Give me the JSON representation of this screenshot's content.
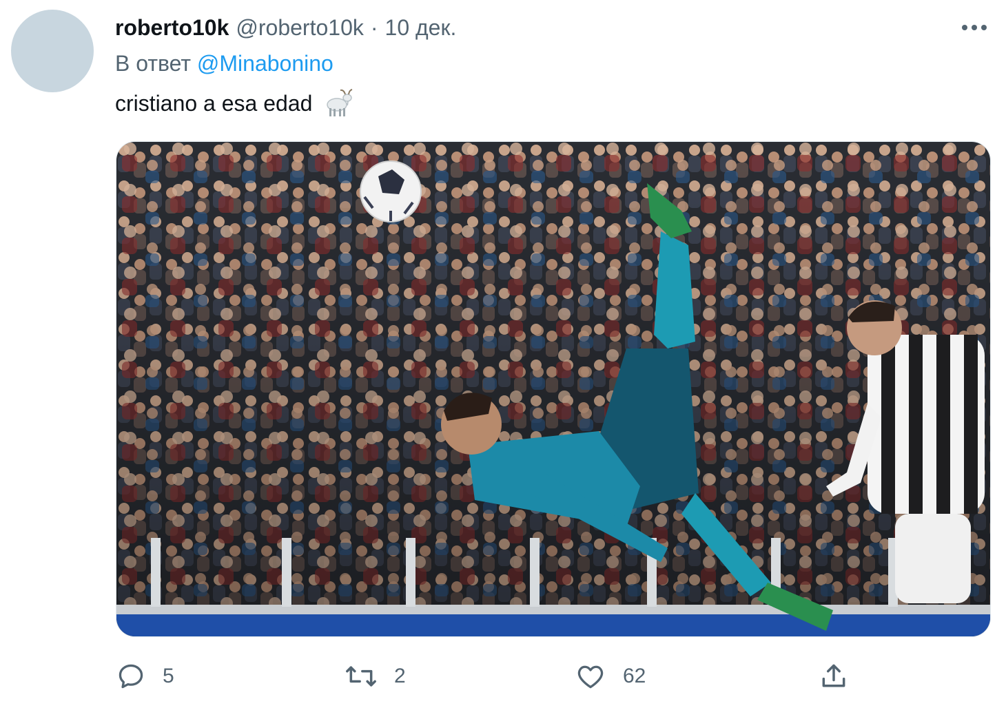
{
  "tweet": {
    "display_name": "roberto10k",
    "handle": "@roberto10k",
    "separator": "·",
    "date": "10 дек.",
    "reply_prefix": "В ответ",
    "reply_to": "@Minabonino",
    "text": "cristiano a esa edad",
    "emoji_icon": "goat-emoji"
  },
  "media": {
    "icon": "photo-football-bicycle-kick"
  },
  "actions": {
    "reply": {
      "icon": "reply-icon",
      "count": "5"
    },
    "retweet": {
      "icon": "retweet-icon",
      "count": "2"
    },
    "like": {
      "icon": "heart-icon",
      "count": "62"
    },
    "share": {
      "icon": "share-icon"
    }
  },
  "colors": {
    "link": "#1d9bf0",
    "secondary_text": "#536471",
    "primary_text": "#0f1419",
    "avatar_placeholder": "#c8d6df"
  }
}
